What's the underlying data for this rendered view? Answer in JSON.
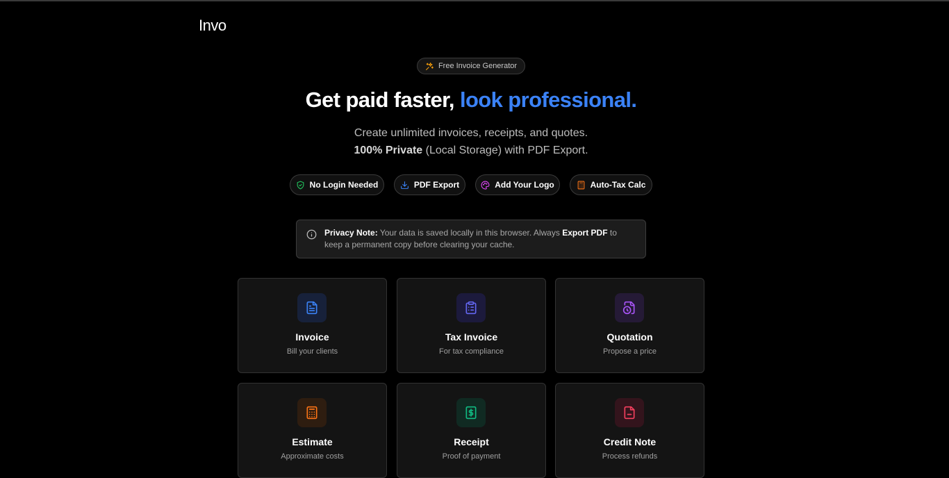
{
  "brand": {
    "logo": "Invo"
  },
  "badge": {
    "label": "Free Invoice Generator",
    "icon": "sparkles-icon",
    "color": "#f59e0b"
  },
  "hero": {
    "title_main": "Get paid faster,",
    "title_accent": "look professional.",
    "subtitle_line1": "Create unlimited invoices, receipts, and quotes.",
    "subtitle_line2_bold": "100% Private",
    "subtitle_line2_rest": "(Local Storage) with PDF Export.",
    "accent_color": "#3b82f6"
  },
  "features": [
    {
      "label": "No Login Needed",
      "icon": "shield-check-icon",
      "color": "#22c55e"
    },
    {
      "label": "PDF Export",
      "icon": "download-icon",
      "color": "#3b82f6"
    },
    {
      "label": "Add Your Logo",
      "icon": "palette-icon",
      "color": "#d946ef"
    },
    {
      "label": "Auto-Tax Calc",
      "icon": "calculator-icon",
      "color": "#f97316"
    }
  ],
  "privacy_note": {
    "label": "Privacy Note:",
    "text_before": "Your data is saved locally in this browser. Always",
    "highlight": "Export PDF",
    "text_after": "to keep a permanent copy before clearing your cache.",
    "icon": "info-icon"
  },
  "documents": [
    {
      "title": "Invoice",
      "description": "Bill your clients",
      "icon": "file-text-icon",
      "color": "#3b82f6"
    },
    {
      "title": "Tax Invoice",
      "description": "For tax compliance",
      "icon": "clipboard-list-icon",
      "color": "#6366f1"
    },
    {
      "title": "Quotation",
      "description": "Propose a price",
      "icon": "file-clock-icon",
      "color": "#a855f7"
    },
    {
      "title": "Estimate",
      "description": "Approximate costs",
      "icon": "calculator-icon",
      "color": "#f97316"
    },
    {
      "title": "Receipt",
      "description": "Proof of payment",
      "icon": "receipt-dollar-icon",
      "color": "#10b981"
    },
    {
      "title": "Credit Note",
      "description": "Process refunds",
      "icon": "file-minus-icon",
      "color": "#f43f5e"
    }
  ]
}
